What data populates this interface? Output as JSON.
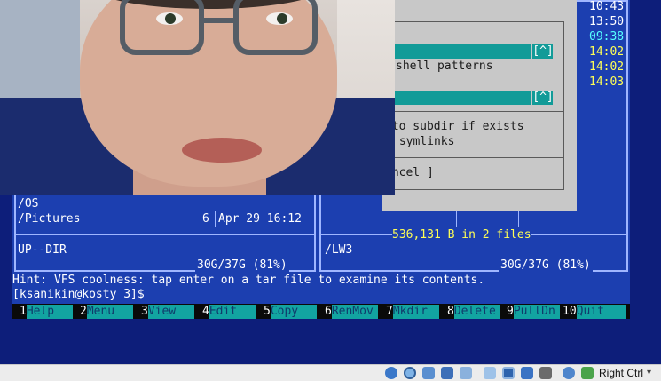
{
  "clock": [
    "10:43",
    "13:50",
    "09:38",
    "14:02",
    "14:02",
    "14:03"
  ],
  "dialog": {
    "caret1": "[^]",
    "caret2": "[^]",
    "line_shell": "shell patterns",
    "line_subdir": "nto subdir if exists",
    "line_symlinks": " symlinks",
    "line_cancel": "ancel ]"
  },
  "left_panel": {
    "path_os": "/OS",
    "row_pictures_name": "/Pictures",
    "row_pictures_size": "6",
    "row_pictures_date": "Apr 29 16:12",
    "mini_status": "UP--DIR",
    "disk_usage": "30G/37G (81%)"
  },
  "right_panel": {
    "summary": "536,131 B in 2 files",
    "mini_status": "/LW3",
    "disk_usage": "30G/37G (81%)"
  },
  "hint": "Hint: VFS coolness: tap enter on a tar file to examine its contents.",
  "prompt": "[ksanikin@kosty 3]$",
  "fkeys": [
    {
      "num": "1",
      "label": "Help"
    },
    {
      "num": "2",
      "label": "Menu"
    },
    {
      "num": "3",
      "label": "View"
    },
    {
      "num": "4",
      "label": "Edit"
    },
    {
      "num": "5",
      "label": "Copy"
    },
    {
      "num": "6",
      "label": "RenMov"
    },
    {
      "num": "7",
      "label": "Mkdir"
    },
    {
      "num": "8",
      "label": "Delete"
    },
    {
      "num": "9",
      "label": "PullDn"
    },
    {
      "num": "10",
      "label": "Quit"
    }
  ],
  "statusbar": {
    "host_key": "Right Ctrl",
    "icons": [
      "hard-disk-icon",
      "optical-disk-icon",
      "audio-icon",
      "network-icon",
      "usb-icon",
      "shared-folder-icon",
      "display-icon",
      "video-capture-icon",
      "cpu-icon",
      "mouse-integration-icon",
      "keyboard-capture-icon"
    ]
  },
  "colors": {
    "panel_bg": "#1c3fb0",
    "accent_cyan": "#12a4a1",
    "clock_yellow": "#ffff55",
    "clock_cyan": "#55ffff"
  }
}
